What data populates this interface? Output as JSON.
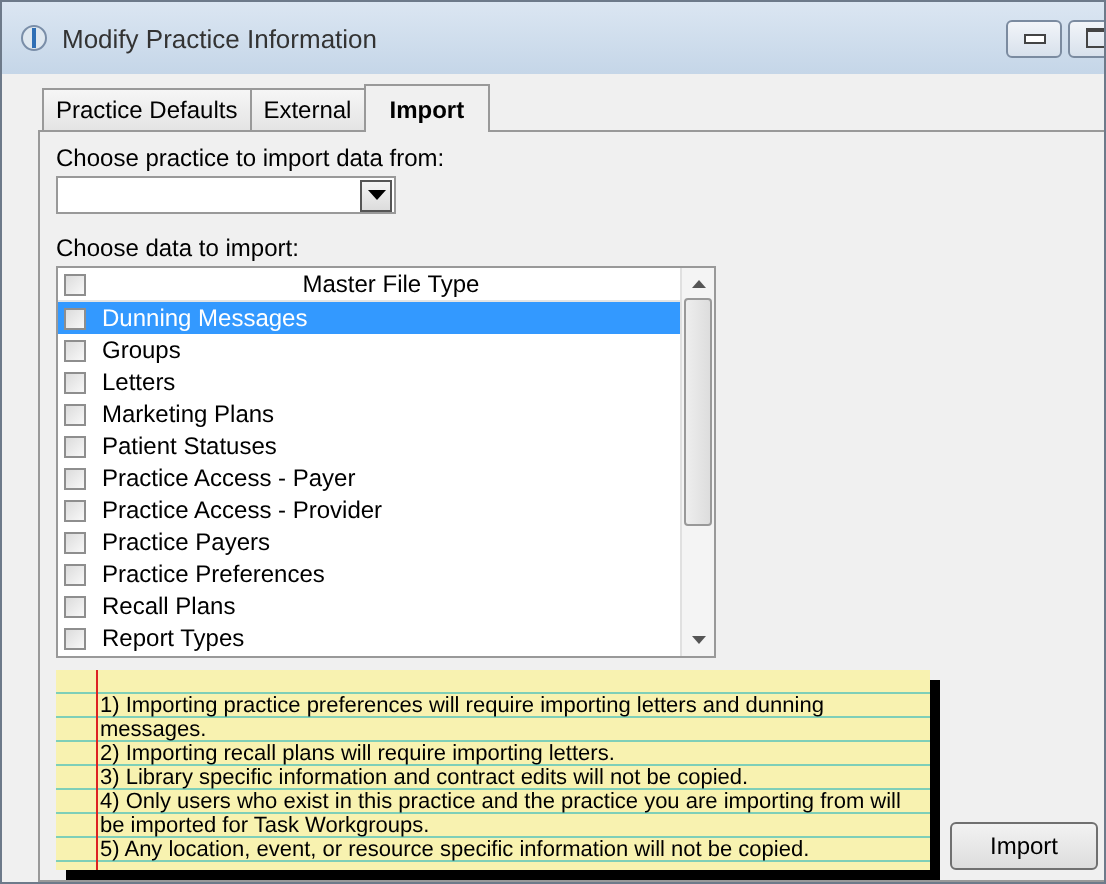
{
  "window": {
    "title": "Modify Practice Information"
  },
  "tabs": [
    {
      "label": "Practice Defaults",
      "selected": false
    },
    {
      "label": "External",
      "selected": false
    },
    {
      "label": "Import",
      "selected": true
    }
  ],
  "practice_picker": {
    "label": "Choose practice to import data from:"
  },
  "data_list": {
    "label": "Choose data to import:",
    "header": "Master File Type",
    "header_checked": false,
    "rows": [
      {
        "name": "Dunning Messages",
        "checked": false,
        "selected": true
      },
      {
        "name": "Groups",
        "checked": false,
        "selected": false
      },
      {
        "name": "Letters",
        "checked": false,
        "selected": false
      },
      {
        "name": "Marketing Plans",
        "checked": false,
        "selected": false
      },
      {
        "name": "Patient Statuses",
        "checked": false,
        "selected": false
      },
      {
        "name": "Practice Access - Payer",
        "checked": false,
        "selected": false
      },
      {
        "name": "Practice Access - Provider",
        "checked": false,
        "selected": false
      },
      {
        "name": "Practice Payers",
        "checked": false,
        "selected": false
      },
      {
        "name": "Practice Preferences",
        "checked": false,
        "selected": false
      },
      {
        "name": "Recall Plans",
        "checked": false,
        "selected": false
      },
      {
        "name": "Report Types",
        "checked": false,
        "selected": false
      }
    ]
  },
  "notes": [
    "1) Importing practice preferences will require importing letters and dunning messages.",
    "2) Importing recall plans will require importing letters.",
    "3) Library specific information and contract edits will not be copied.",
    "4) Only users who exist in this practice and the practice you are importing from will be imported for Task Workgroups.",
    "5) Any location, event, or resource specific information will not be copied."
  ],
  "buttons": [
    "Import"
  ]
}
